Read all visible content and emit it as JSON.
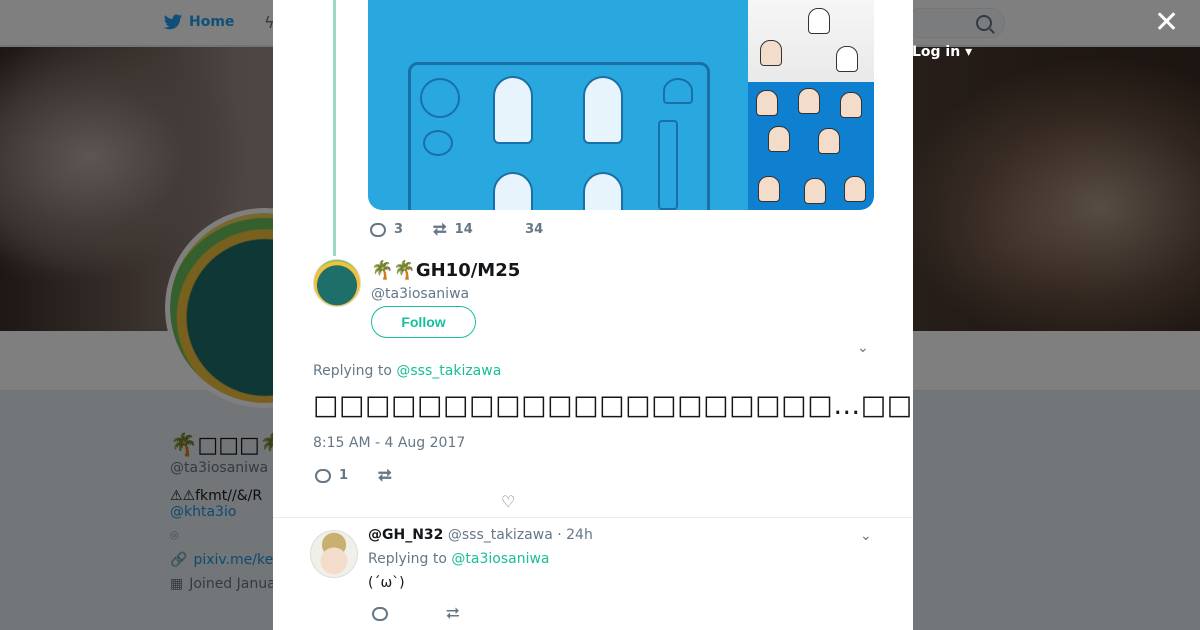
{
  "nav": {
    "home_label": "Home",
    "login_label": "Log in"
  },
  "profile": {
    "name": "🌴",
    "name_suffix": "🌴G",
    "handle": "@ta3iosaniwa",
    "bio_start": "⚠⚠fkmt//&/R",
    "bio_link": "@khta3io",
    "website": "pixiv.me/ke",
    "joined": "Joined Janua"
  },
  "thread": {
    "prev_tweet": {
      "reply_count": "3",
      "retweet_count": "14",
      "like_count": "34"
    }
  },
  "tweet": {
    "author_name": "🌴🌴GH10/M25",
    "author_handle": "@ta3iosaniwa",
    "follow_label": "Follow",
    "replying_prefix": "Replying to",
    "replying_to": "@sss_takizawa",
    "text": "□□□□□□□□□□□□□□□□□□□□…□□□□□□□□□…□□□□□□□□□□□□□□□□□□",
    "timestamp": "8:15 AM - 4 Aug 2017",
    "reply_count": "1"
  },
  "reply": {
    "name": "@GH_N32",
    "handle": "@sss_takizawa",
    "sep": "·",
    "time": "24h",
    "replying_prefix": "Replying to",
    "replying_to": "@ta3iosaniwa",
    "text": "(´ω`)"
  },
  "colors": {
    "accent": "#17bf9a",
    "twitter_blue": "#1da1f2",
    "media_blue": "#29a8e0"
  },
  "icons": [
    "twitter-bird-icon",
    "close-icon",
    "reply-icon",
    "retweet-icon",
    "heart-icon",
    "chevron-down-icon",
    "search-icon",
    "location-icon",
    "link-icon",
    "calendar-icon"
  ]
}
